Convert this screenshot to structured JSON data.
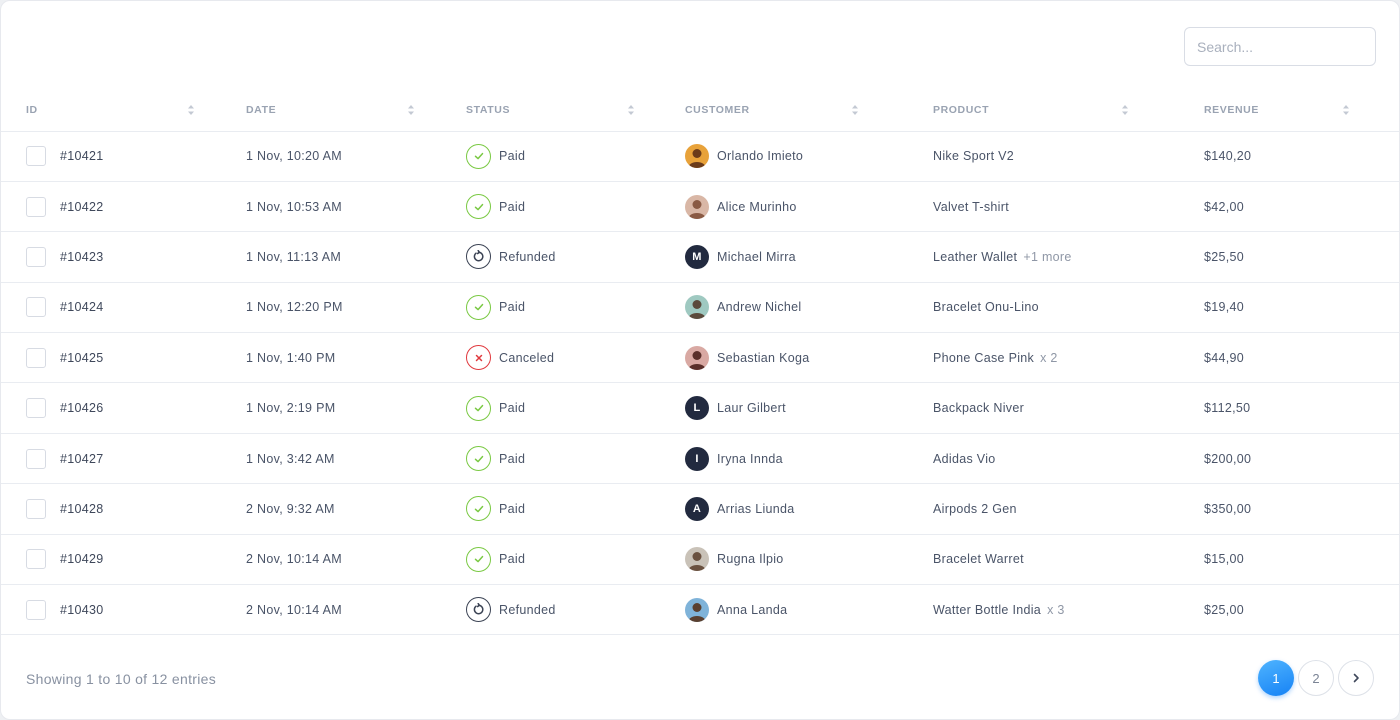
{
  "search": {
    "placeholder": "Search..."
  },
  "columns": [
    "ID",
    "DATE",
    "STATUS",
    "CUSTOMER",
    "PRODUCT",
    "REVENUE"
  ],
  "colors": {
    "paid": "#7ac943",
    "refunded": "#3b4354",
    "canceled": "#e0393e",
    "accent": "#1682f5"
  },
  "rows": [
    {
      "id": "#10421",
      "date": "1 Nov, 10:20 AM",
      "status": "Paid",
      "status_type": "paid",
      "customer": "Orlando Imieto",
      "avatar": {
        "type": "photo",
        "bg": "#e8a23a",
        "fg": "#6b3b1a"
      },
      "product": "Nike Sport V2",
      "extra": "",
      "revenue": "$140,20"
    },
    {
      "id": "#10422",
      "date": "1 Nov, 10:53 AM",
      "status": "Paid",
      "status_type": "paid",
      "customer": "Alice Murinho",
      "avatar": {
        "type": "photo",
        "bg": "#d9b7a6",
        "fg": "#8a5a44"
      },
      "product": "Valvet T-shirt",
      "extra": "",
      "revenue": "$42,00"
    },
    {
      "id": "#10423",
      "date": "1 Nov, 11:13 AM",
      "status": "Refunded",
      "status_type": "refunded",
      "customer": "Michael Mirra",
      "avatar": {
        "type": "letter",
        "letter": "M"
      },
      "product": "Leather Wallet",
      "extra": "+1 more",
      "revenue": "$25,50"
    },
    {
      "id": "#10424",
      "date": "1 Nov, 12:20 PM",
      "status": "Paid",
      "status_type": "paid",
      "customer": "Andrew Nichel",
      "avatar": {
        "type": "photo",
        "bg": "#9fc9c1",
        "fg": "#5b4a3c"
      },
      "product": "Bracelet Onu-Lino",
      "extra": "",
      "revenue": "$19,40"
    },
    {
      "id": "#10425",
      "date": "1 Nov, 1:40 PM",
      "status": "Canceled",
      "status_type": "canceled",
      "customer": "Sebastian Koga",
      "avatar": {
        "type": "photo",
        "bg": "#d9a9a3",
        "fg": "#5a2f2a"
      },
      "product": "Phone Case Pink",
      "extra": "x 2",
      "revenue": "$44,90"
    },
    {
      "id": "#10426",
      "date": "1 Nov, 2:19 PM",
      "status": "Paid",
      "status_type": "paid",
      "customer": "Laur Gilbert",
      "avatar": {
        "type": "letter",
        "letter": "L"
      },
      "product": "Backpack Niver",
      "extra": "",
      "revenue": "$112,50"
    },
    {
      "id": "#10427",
      "date": "1 Nov, 3:42 AM",
      "status": "Paid",
      "status_type": "paid",
      "customer": "Iryna Innda",
      "avatar": {
        "type": "letter",
        "letter": "I"
      },
      "product": "Adidas Vio",
      "extra": "",
      "revenue": "$200,00"
    },
    {
      "id": "#10428",
      "date": "2 Nov, 9:32 AM",
      "status": "Paid",
      "status_type": "paid",
      "customer": "Arrias Liunda",
      "avatar": {
        "type": "letter",
        "letter": "A"
      },
      "product": "Airpods 2 Gen",
      "extra": "",
      "revenue": "$350,00"
    },
    {
      "id": "#10429",
      "date": "2 Nov, 10:14 AM",
      "status": "Paid",
      "status_type": "paid",
      "customer": "Rugna Ilpio",
      "avatar": {
        "type": "photo",
        "bg": "#c9c2b8",
        "fg": "#6a5140"
      },
      "product": "Bracelet Warret",
      "extra": "",
      "revenue": "$15,00"
    },
    {
      "id": "#10430",
      "date": "2 Nov, 10:14 AM",
      "status": "Refunded",
      "status_type": "refunded",
      "customer": "Anna Landa",
      "avatar": {
        "type": "photo",
        "bg": "#7fb3d9",
        "fg": "#5a4030"
      },
      "product": "Watter Bottle India",
      "extra": "x 3",
      "revenue": "$25,00"
    }
  ],
  "footer": {
    "showing_text": "Showing 1 to 10 of 12 entries"
  },
  "pagination": {
    "pages": [
      "1",
      "2"
    ],
    "current": "1",
    "next_icon": "chevron-right-icon"
  }
}
